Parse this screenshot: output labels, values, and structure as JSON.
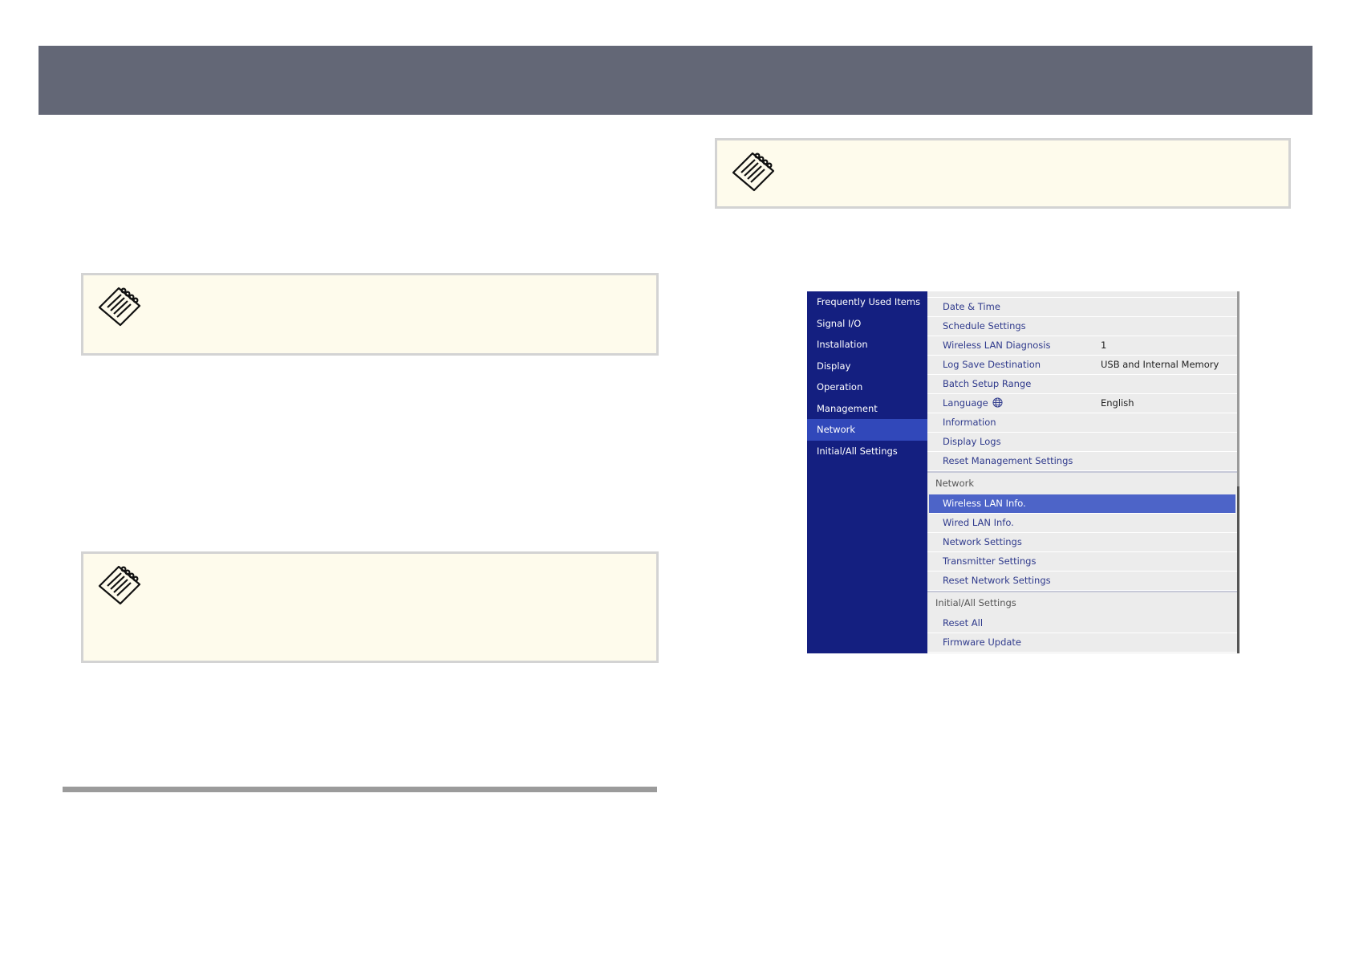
{
  "colors": {
    "header": "#636776",
    "note_bg": "#fefbec",
    "note_border": "#d3d3d3",
    "menu_sidebar": "#141f80",
    "menu_sidebar_active": "#3148ba",
    "menu_selected": "#4d64c8",
    "menu_text": "#2f3a8c"
  },
  "notes": [
    {
      "icon": "note-icon"
    },
    {
      "icon": "note-icon"
    },
    {
      "icon": "note-icon"
    }
  ],
  "menu": {
    "sidebar": [
      {
        "label": "Frequently Used Items"
      },
      {
        "label": "Signal I/O"
      },
      {
        "label": "Installation"
      },
      {
        "label": "Display"
      },
      {
        "label": "Operation"
      },
      {
        "label": "Management"
      },
      {
        "label": "Network",
        "active": true
      },
      {
        "label": "Initial/All Settings"
      }
    ],
    "management_rows": [
      {
        "label": "Date & Time",
        "value": ""
      },
      {
        "label": "Schedule Settings",
        "value": ""
      },
      {
        "label": "Wireless LAN Diagnosis",
        "value": "1"
      },
      {
        "label": "Log Save Destination",
        "value": "USB and Internal Memory"
      },
      {
        "label": "Batch Setup Range",
        "value": ""
      },
      {
        "label": "Language",
        "value": "English",
        "icon": "globe-icon"
      },
      {
        "label": "Information",
        "value": ""
      },
      {
        "label": "Display Logs",
        "value": ""
      },
      {
        "label": "Reset Management Settings",
        "value": ""
      }
    ],
    "network_section": {
      "title": "Network",
      "rows": [
        {
          "label": "Wireless LAN Info.",
          "selected": true
        },
        {
          "label": "Wired LAN Info."
        },
        {
          "label": "Network Settings"
        },
        {
          "label": "Transmitter Settings"
        },
        {
          "label": "Reset Network Settings"
        }
      ]
    },
    "initial_section": {
      "title": "Initial/All Settings",
      "rows": [
        {
          "label": "Reset All"
        },
        {
          "label": "Firmware Update"
        }
      ]
    }
  }
}
